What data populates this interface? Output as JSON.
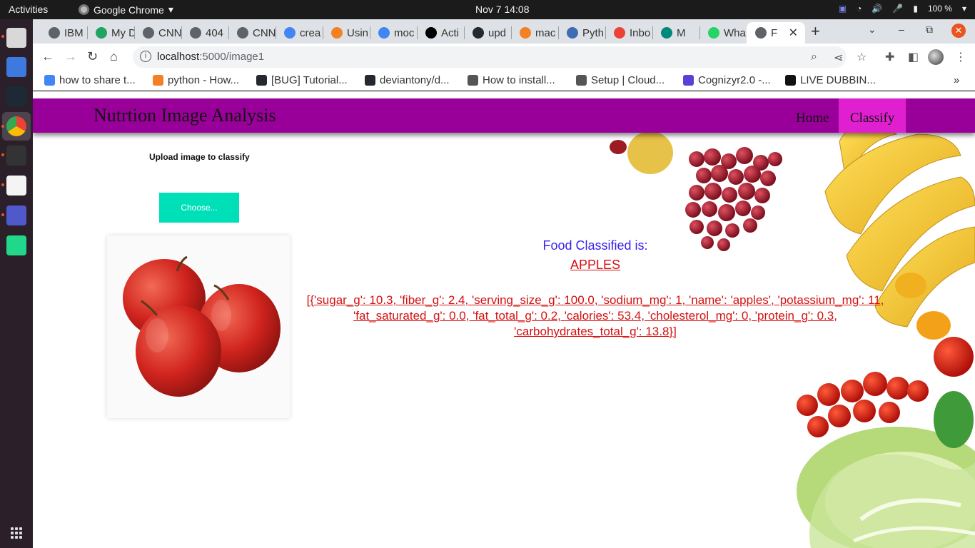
{
  "system": {
    "activities": "Activities",
    "app_menu": "Google Chrome",
    "clock": "Nov 7  14:08",
    "battery": "100 %"
  },
  "browser": {
    "tabs": [
      {
        "label": "IBM",
        "color": "#5f6368"
      },
      {
        "label": "My D",
        "color": "#1fa463"
      },
      {
        "label": "CNN",
        "color": "#5f6368"
      },
      {
        "label": "404",
        "color": "#5f6368"
      },
      {
        "label": "CNN",
        "color": "#5f6368"
      },
      {
        "label": "crea",
        "color": "#4285f4"
      },
      {
        "label": "Usin",
        "color": "#f48024"
      },
      {
        "label": "moc",
        "color": "#4285f4"
      },
      {
        "label": "Acti",
        "color": "#000000"
      },
      {
        "label": "upd",
        "color": "#24292f"
      },
      {
        "label": "mac",
        "color": "#f48024"
      },
      {
        "label": "Pyth",
        "color": "#3f6db3"
      },
      {
        "label": "Inbo",
        "color": "#ea4335"
      },
      {
        "label": "M",
        "color": "#00897b"
      },
      {
        "label": "Wha",
        "color": "#25d366"
      },
      {
        "label": "F",
        "color": "#5f6368"
      }
    ],
    "url_host": "localhost",
    "url_path": ":5000/image1",
    "bookmarks": [
      {
        "label": "how to share t...",
        "color": "#4285f4"
      },
      {
        "label": "python - How...",
        "color": "#f48024"
      },
      {
        "label": "[BUG] Tutorial...",
        "color": "#24292f"
      },
      {
        "label": "deviantony/d...",
        "color": "#24292f"
      },
      {
        "label": "How to install...",
        "color": "#555555"
      },
      {
        "label": "Setup | Cloud...",
        "color": "#555555"
      },
      {
        "label": "Cognizyr2.0 -...",
        "color": "#5b3fd6"
      },
      {
        "label": "LIVE DUBBIN...",
        "color": "#111111"
      }
    ]
  },
  "site": {
    "title": "Nutrtion Image Analysis",
    "nav": {
      "home": "Home",
      "classify": "Classify"
    },
    "upload_label": "Upload image to classify",
    "choose_button": "Choose...",
    "result_heading": "Food Classified is:",
    "result_food": "APPLES",
    "result_data": "[{'sugar_g': 10.3, 'fiber_g': 2.4, 'serving_size_g': 100.0, 'sodium_mg': 1, 'name': 'apples', 'potassium_mg': 11, 'fat_saturated_g': 0.0, 'fat_total_g': 0.2, 'calories': 53.4, 'cholesterol_mg': 0, 'protein_g': 0.3, 'carbohydrates_total_g': 13.8}]"
  },
  "colors": {
    "header": "#990099",
    "nav_active": "#e020d0",
    "choose_button": "#00e0b8",
    "result_heading": "#3a22ee",
    "result_text": "#d41111"
  }
}
